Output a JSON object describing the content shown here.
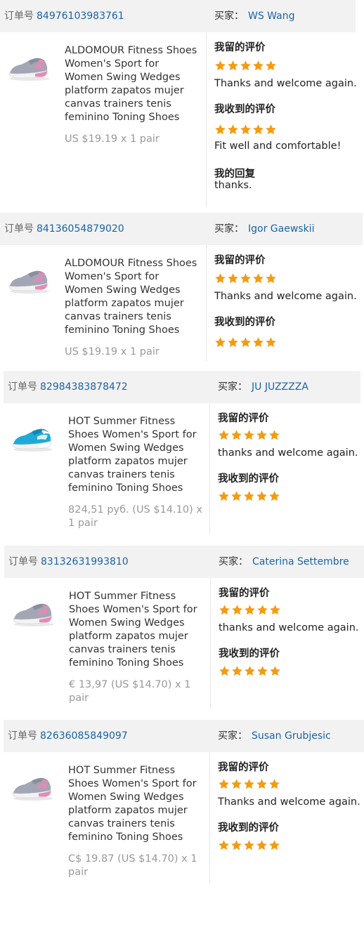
{
  "labels": {
    "order_no": "订单号",
    "buyer": "买家：",
    "review_left": "我留的评价",
    "review_received": "我收到的评价",
    "my_reply": "我的回复"
  },
  "colors": {
    "link": "#1a63a8",
    "star": "#f39c12",
    "header_bg": "#f2f2f2",
    "price": "#999999"
  },
  "orders": [
    {
      "order_number": "84976103983761",
      "buyer_name": "WS Wang",
      "product_title_lines": [
        "ALDOMOUR Fitness Shoes",
        "Women's Sport for",
        "Women Swing Wedges",
        "platform zapatos mujer",
        "canvas trainers tenis",
        "feminino Toning Shoes"
      ],
      "price_lines": [
        "US $19.19 x 1 pair"
      ],
      "shoe_color": "gray-pink",
      "review_left_stars": 5,
      "review_left_text": "Thanks and welcome again.",
      "review_received_stars": 5,
      "review_received_text": "Fit well and comfortable!",
      "reply_text": "thanks."
    },
    {
      "order_number": "84136054879020",
      "buyer_name": "Igor Gaewskii",
      "product_title_lines": [
        "ALDOMOUR Fitness Shoes",
        "Women's Sport for",
        "Women Swing Wedges",
        "platform zapatos mujer",
        "canvas trainers tenis",
        "feminino Toning Shoes"
      ],
      "price_lines": [
        "US $19.19 x 1 pair"
      ],
      "shoe_color": "gray-pink",
      "review_left_stars": 5,
      "review_left_text": "Thanks and welcome again.",
      "review_received_stars": 5,
      "review_received_text": "",
      "reply_text": ""
    },
    {
      "order_number": "82984383878472",
      "buyer_name": "JU JUZZZZA",
      "product_title_lines": [
        "HOT Summer Fitness",
        "Shoes Women's Sport for",
        "Women Swing Wedges",
        "platform zapatos mujer",
        "canvas trainers tenis",
        "feminino Toning Shoes"
      ],
      "price_lines": [
        "824,51 руб. (US $14.10) x",
        "1 pair"
      ],
      "shoe_color": "blue-white",
      "review_left_stars": 5,
      "review_left_text": "thanks and welcome again.",
      "review_received_stars": 5,
      "review_received_text": "",
      "reply_text": ""
    },
    {
      "order_number": "83132631993810",
      "buyer_name": "Caterina Settembre",
      "product_title_lines": [
        "HOT Summer Fitness",
        "Shoes Women's Sport for",
        "Women Swing Wedges",
        "platform zapatos mujer",
        "canvas trainers tenis",
        "feminino Toning Shoes"
      ],
      "price_lines": [
        "€ 13,97 (US $14.70) x 1",
        "pair"
      ],
      "shoe_color": "gray-pink",
      "review_left_stars": 5,
      "review_left_text": "thanks and welcome again.",
      "review_received_stars": 5,
      "review_received_text": "",
      "reply_text": ""
    },
    {
      "order_number": "82636085849097",
      "buyer_name": "Susan Grubjesic",
      "product_title_lines": [
        "HOT Summer Fitness",
        "Shoes Women's Sport for",
        "Women Swing Wedges",
        "platform zapatos mujer",
        "canvas trainers tenis",
        "feminino Toning Shoes"
      ],
      "price_lines": [
        "C$ 19.87 (US $14.70) x 1",
        "pair"
      ],
      "shoe_color": "gray-pink",
      "review_left_stars": 5,
      "review_left_text": "Thanks and welcome again.",
      "review_received_stars": 5,
      "review_received_text": "",
      "reply_text": ""
    }
  ]
}
